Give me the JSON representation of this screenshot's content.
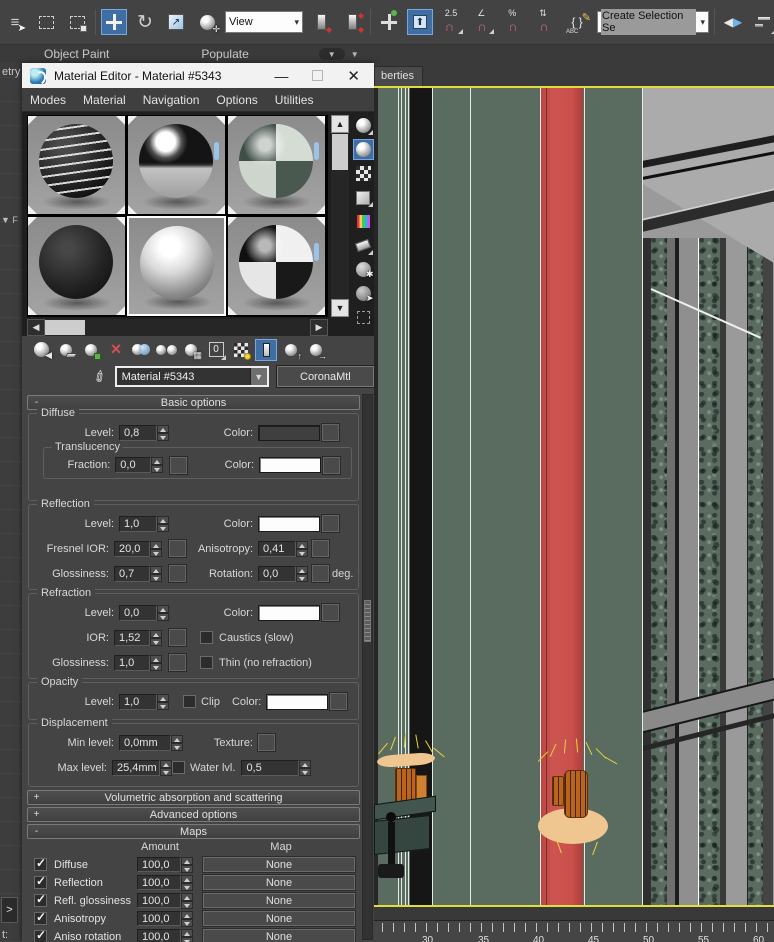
{
  "top_toolbar": {
    "view_dropdown": "View",
    "selection_set_value": "Create Selection Se",
    "snap_25_label": "2.5",
    "percent_label": "%",
    "named_sets_label": "ABC"
  },
  "ribbon": {
    "tabs": [
      "Object Paint",
      "Populate"
    ]
  },
  "left_strip": {
    "top_text": "etry",
    "panel_letter": "F",
    "bottom_text": "t:",
    "expand_label": ">"
  },
  "material_editor": {
    "title": "Material Editor - Material #5343",
    "menus": [
      "Modes",
      "Material",
      "Navigation",
      "Options",
      "Utilities"
    ],
    "name_value": "Material #5343",
    "type_button": "CoronaMtl",
    "id_channel": "0"
  },
  "basic_options": {
    "title": "Basic options",
    "state": "-",
    "diffuse": {
      "legend": "Diffuse",
      "level_label": "Level:",
      "level": "0,8",
      "color_label": "Color:"
    },
    "translucency": {
      "legend": "Translucency",
      "fraction_label": "Fraction:",
      "fraction": "0,0",
      "color_label": "Color:"
    },
    "reflection": {
      "legend": "Reflection",
      "level_label": "Level:",
      "level": "1,0",
      "color_label": "Color:",
      "fresnel_label": "Fresnel IOR:",
      "fresnel": "20,0",
      "anisotropy_label": "Anisotropy:",
      "anisotropy": "0,41",
      "glossiness_label": "Glossiness:",
      "glossiness": "0,7",
      "rotation_label": "Rotation:",
      "rotation": "0,0",
      "deg_label": "deg."
    },
    "refraction": {
      "legend": "Refraction",
      "level_label": "Level:",
      "level": "0,0",
      "color_label": "Color:",
      "ior_label": "IOR:",
      "ior": "1,52",
      "caustics_label": "Caustics (slow)",
      "glossiness_label": "Glossiness:",
      "glossiness": "1,0",
      "thin_label": "Thin (no refraction)"
    },
    "opacity": {
      "legend": "Opacity",
      "level_label": "Level:",
      "level": "1,0",
      "clip_label": "Clip",
      "color_label": "Color:"
    },
    "displacement": {
      "legend": "Displacement",
      "min_label": "Min level:",
      "min": "0,0mm",
      "texture_label": "Texture:",
      "max_label": "Max level:",
      "max": "25,4mm",
      "water_label": "Water lvl.",
      "water": "0,5"
    }
  },
  "rollouts": {
    "volumetric": {
      "title": "Volumetric absorption and scattering",
      "state": "+"
    },
    "advanced": {
      "title": "Advanced options",
      "state": "+"
    },
    "maps": {
      "title": "Maps",
      "state": "-"
    }
  },
  "maps_table": {
    "amount_header": "Amount",
    "map_header": "Map",
    "rows": [
      {
        "label": "Diffuse",
        "amount": "100,0",
        "map": "None",
        "checked": true
      },
      {
        "label": "Reflection",
        "amount": "100,0",
        "map": "None",
        "checked": true
      },
      {
        "label": "Refl. glossiness",
        "amount": "100,0",
        "map": "None",
        "checked": true
      },
      {
        "label": "Anisotropy",
        "amount": "100,0",
        "map": "None",
        "checked": true
      },
      {
        "label": "Aniso rotation",
        "amount": "100,0",
        "map": "None",
        "checked": true
      }
    ]
  },
  "viewport": {
    "panel_tab": "berties",
    "timeline_labels": [
      "30",
      "35",
      "40",
      "45",
      "50",
      "55",
      "60"
    ]
  },
  "colors": {
    "accent_blue": "#3f6ea5",
    "selection_red": "#c9504b",
    "viewport_border_yellow": "#dede3e",
    "granite_green": "#5a6b60",
    "sconce_orange": "#b9651f",
    "light_tan": "#f0c690"
  }
}
